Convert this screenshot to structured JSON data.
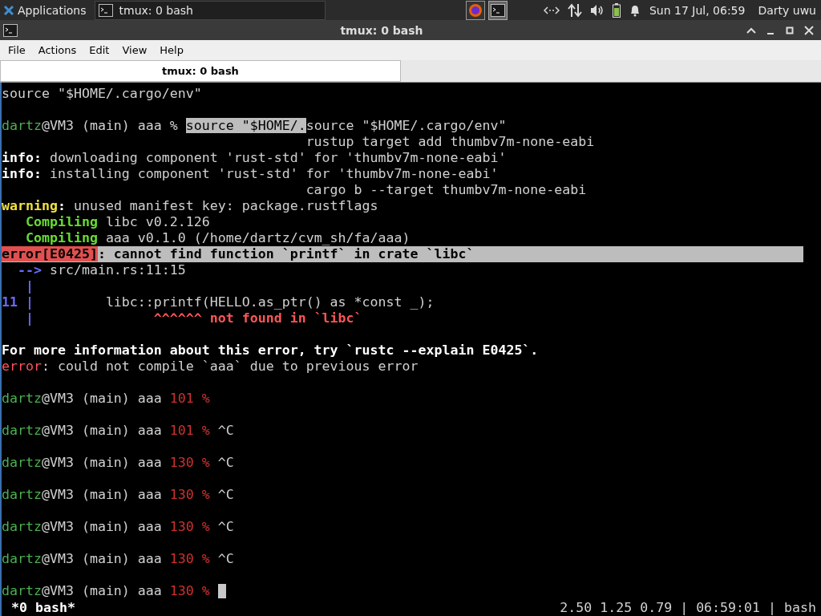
{
  "panel": {
    "apps_menu": "Applications",
    "tasks": [
      {
        "label": "tmux: 0 bash",
        "selected": true
      }
    ],
    "clock": "Sun 17 Jul, 06:59",
    "user": "Darty uwu"
  },
  "window": {
    "title": "tmux: 0 bash"
  },
  "menu": [
    "File",
    "Actions",
    "Edit",
    "View",
    "Help"
  ],
  "tabs": [
    {
      "label": "tmux: 0 bash",
      "selected": true
    }
  ],
  "terminal": {
    "lines": [
      {
        "segments": [
          {
            "kind": "plain",
            "text": "source \"$HOME/.cargo/env\""
          }
        ]
      },
      {
        "blank": true
      },
      {
        "segments": [
          {
            "kind": "green",
            "text": "dartz"
          },
          {
            "kind": "plain",
            "text": "@VM3 (main) aaa % "
          },
          {
            "kind": "selection",
            "text": "source \"$HOME/."
          },
          {
            "kind": "plain",
            "text": "source \"$HOME/.cargo/env\""
          }
        ]
      },
      {
        "segments": [
          {
            "kind": "plain",
            "text": "                                      rustup target add thumbv7m-none-eabi"
          }
        ]
      },
      {
        "segments": [
          {
            "kind": "bold",
            "text": "info:"
          },
          {
            "kind": "plain",
            "text": " downloading component 'rust-std' for 'thumbv7m-none-eabi'"
          }
        ]
      },
      {
        "segments": [
          {
            "kind": "bold",
            "text": "info:"
          },
          {
            "kind": "plain",
            "text": " installing component 'rust-std' for 'thumbv7m-none-eabi'"
          }
        ]
      },
      {
        "segments": [
          {
            "kind": "plain",
            "text": "                                      cargo b --target thumbv7m-none-eabi"
          }
        ]
      },
      {
        "segments": [
          {
            "kind": "warning",
            "text": "warning"
          },
          {
            "kind": "bold",
            "text": ":"
          },
          {
            "kind": "plain",
            "text": " unused manifest key: package.rustflags"
          }
        ]
      },
      {
        "segments": [
          {
            "kind": "compiling",
            "text": "   Compiling"
          },
          {
            "kind": "plain",
            "text": " libc v0.2.126"
          }
        ]
      },
      {
        "segments": [
          {
            "kind": "compiling",
            "text": "   Compiling"
          },
          {
            "kind": "plain",
            "text": " aaa v0.1.0 (/home/dartz/cvm_sh/fa/aaa)"
          }
        ]
      },
      {
        "highlighted": true,
        "segments": [
          {
            "kind": "error-badge",
            "text": "error[E0425]"
          },
          {
            "kind": "bold",
            "text": ": cannot find function `printf` in crate `libc`"
          }
        ]
      },
      {
        "segments": [
          {
            "kind": "blue",
            "text": "  -->"
          },
          {
            "kind": "plain",
            "text": " src/main.rs:11:15"
          }
        ]
      },
      {
        "segments": [
          {
            "kind": "blue",
            "text": "   |"
          }
        ]
      },
      {
        "segments": [
          {
            "kind": "blue",
            "text": "11 |"
          },
          {
            "kind": "plain",
            "text": "         libc::printf(HELLO.as_ptr() as *const _);"
          }
        ]
      },
      {
        "segments": [
          {
            "kind": "blue",
            "text": "   |"
          },
          {
            "kind": "error-bold",
            "text": "               ^^^^^^ not found in `libc`"
          }
        ]
      },
      {
        "blank": true
      },
      {
        "segments": [
          {
            "kind": "bold",
            "text": "For more information about this error, try `rustc --explain E0425`."
          }
        ]
      },
      {
        "segments": [
          {
            "kind": "error",
            "text": "error"
          },
          {
            "kind": "plain",
            "text": ": could not compile `aaa` due to previous error"
          }
        ]
      },
      {
        "blank": true
      },
      {
        "segments": [
          {
            "kind": "green",
            "text": "dartz"
          },
          {
            "kind": "plain",
            "text": "@VM3 (main) aaa "
          },
          {
            "kind": "red",
            "text": "101 %"
          }
        ]
      },
      {
        "blank": true
      },
      {
        "segments": [
          {
            "kind": "green",
            "text": "dartz"
          },
          {
            "kind": "plain",
            "text": "@VM3 (main) aaa "
          },
          {
            "kind": "red",
            "text": "101 %"
          },
          {
            "kind": "plain",
            "text": " ^C"
          }
        ]
      },
      {
        "blank": true
      },
      {
        "segments": [
          {
            "kind": "green",
            "text": "dartz"
          },
          {
            "kind": "plain",
            "text": "@VM3 (main) aaa "
          },
          {
            "kind": "red",
            "text": "130 %"
          },
          {
            "kind": "plain",
            "text": " ^C"
          }
        ]
      },
      {
        "blank": true
      },
      {
        "segments": [
          {
            "kind": "green",
            "text": "dartz"
          },
          {
            "kind": "plain",
            "text": "@VM3 (main) aaa "
          },
          {
            "kind": "red",
            "text": "130 %"
          },
          {
            "kind": "plain",
            "text": " ^C"
          }
        ]
      },
      {
        "blank": true
      },
      {
        "segments": [
          {
            "kind": "green",
            "text": "dartz"
          },
          {
            "kind": "plain",
            "text": "@VM3 (main) aaa "
          },
          {
            "kind": "red",
            "text": "130 %"
          },
          {
            "kind": "plain",
            "text": " ^C"
          }
        ]
      },
      {
        "blank": true
      },
      {
        "segments": [
          {
            "kind": "green",
            "text": "dartz"
          },
          {
            "kind": "plain",
            "text": "@VM3 (main) aaa "
          },
          {
            "kind": "red",
            "text": "130 %"
          },
          {
            "kind": "plain",
            "text": " ^C"
          }
        ]
      },
      {
        "blank": true
      },
      {
        "cursor": true,
        "segments": [
          {
            "kind": "green",
            "text": "dartz"
          },
          {
            "kind": "plain",
            "text": "@VM3 (main) aaa "
          },
          {
            "kind": "red",
            "text": "130 %"
          }
        ]
      }
    ]
  },
  "status_bar": {
    "left": "*0 bash*",
    "right": "2.50 1.25 0.79 | 06:59:01 | bash"
  }
}
